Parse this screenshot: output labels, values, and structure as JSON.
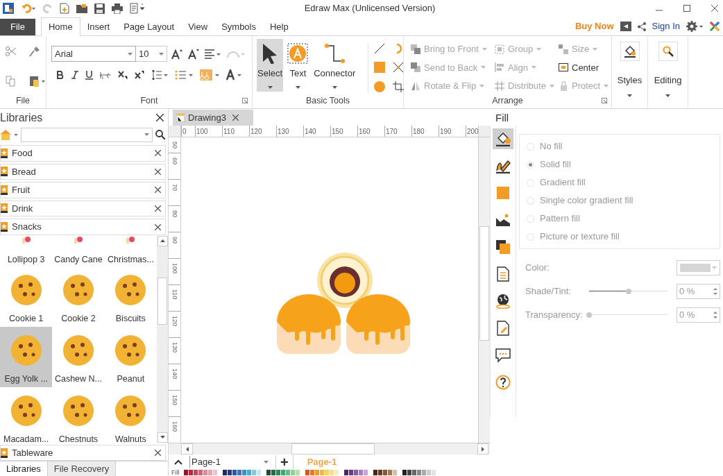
{
  "window": {
    "title": "Edraw Max (Unlicensed Version)"
  },
  "menu_tabs": [
    {
      "label": "File",
      "kind": "file",
      "selected": false
    },
    {
      "label": "Home",
      "kind": "tab",
      "selected": true
    },
    {
      "label": "Insert",
      "kind": "tab",
      "selected": false
    },
    {
      "label": "Page Layout",
      "kind": "tab",
      "selected": false
    },
    {
      "label": "View",
      "kind": "tab",
      "selected": false
    },
    {
      "label": "Symbols",
      "kind": "tab",
      "selected": false
    },
    {
      "label": "Help",
      "kind": "tab",
      "selected": false
    }
  ],
  "header_actions": {
    "buy_now": "Buy Now",
    "sign_in": "Sign In"
  },
  "ribbon": {
    "file_group": {
      "title": "File"
    },
    "font": {
      "title": "Font",
      "font_name": "Arial",
      "font_size": "10"
    },
    "basic_tools": {
      "title": "Basic Tools",
      "tools": [
        {
          "label": "Select",
          "selected": true
        },
        {
          "label": "Text",
          "selected": false
        },
        {
          "label": "Connector",
          "selected": false
        }
      ]
    },
    "arrange": {
      "title": "Arrange",
      "items": [
        {
          "label": "Bring to Front",
          "disabled": true,
          "dropdown": true
        },
        {
          "label": "Group",
          "disabled": true,
          "dropdown": true
        },
        {
          "label": "Size",
          "disabled": true,
          "dropdown": true
        },
        {
          "label": "Send to Back",
          "disabled": true,
          "dropdown": true
        },
        {
          "label": "Align",
          "disabled": true,
          "dropdown": true
        },
        {
          "label": "Center",
          "disabled": false,
          "dropdown": false
        },
        {
          "label": "Rotate & Flip",
          "disabled": true,
          "dropdown": true
        },
        {
          "label": "Distribute",
          "disabled": true,
          "dropdown": true
        },
        {
          "label": "Protect",
          "disabled": true,
          "dropdown": true
        }
      ]
    },
    "styles": {
      "label": "Styles"
    },
    "editing": {
      "label": "Editing"
    }
  },
  "libraries": {
    "title": "Libraries",
    "categories": [
      {
        "label": "Food",
        "expanded": false
      },
      {
        "label": "Bread",
        "expanded": false
      },
      {
        "label": "Fruit",
        "expanded": false
      },
      {
        "label": "Drink",
        "expanded": false
      },
      {
        "label": "Snacks",
        "expanded": true,
        "shapes": [
          {
            "label": "Lollipop 3",
            "selected": false
          },
          {
            "label": "Candy Cane",
            "selected": false
          },
          {
            "label": "Christmas...",
            "selected": false
          },
          {
            "label": "Cookie 1",
            "selected": false
          },
          {
            "label": "Cookie 2",
            "selected": false
          },
          {
            "label": "Biscuits",
            "selected": false
          },
          {
            "label": "Egg Yolk ...",
            "selected": true
          },
          {
            "label": "Cashew N...",
            "selected": false
          },
          {
            "label": "Peanut",
            "selected": false
          },
          {
            "label": "Macadam...",
            "selected": false
          },
          {
            "label": "Chestnuts",
            "selected": false
          },
          {
            "label": "Walnuts",
            "selected": false
          }
        ]
      },
      {
        "label": "Tableware",
        "expanded": false
      }
    ],
    "bottom_tabs": [
      {
        "label": "Libraries",
        "selected": true
      },
      {
        "label": "File Recovery",
        "selected": false
      }
    ]
  },
  "document_tab": {
    "label": "Drawing3"
  },
  "ruler": {
    "horizontal": [
      "0",
      "100",
      "110",
      "120",
      "130",
      "140",
      "150",
      "160",
      "170",
      "180",
      "190",
      "200"
    ],
    "vertical": [
      "50",
      "60",
      "70",
      "80",
      "90",
      "100",
      "110",
      "120",
      "130",
      "140",
      "150",
      "160"
    ]
  },
  "page_bar": {
    "page_select": "Page-1",
    "add": "+",
    "pages": [
      {
        "label": "Page-1",
        "selected": true
      }
    ]
  },
  "palette_label": "Fill",
  "side_tools": [
    {
      "kind": "fill",
      "selected": true
    },
    {
      "kind": "line",
      "selected": false
    },
    {
      "kind": "shadow",
      "selected": false
    },
    {
      "kind": "image",
      "selected": false
    },
    {
      "kind": "layer",
      "selected": false
    },
    {
      "kind": "page",
      "selected": false
    },
    {
      "kind": "globe",
      "selected": false
    },
    {
      "kind": "note",
      "selected": false
    },
    {
      "kind": "comment",
      "selected": false
    },
    {
      "kind": "help",
      "selected": false
    }
  ],
  "fill_panel": {
    "title": "Fill",
    "options": [
      {
        "label": "No fill",
        "selected": false,
        "disabled": true
      },
      {
        "label": "Solid fill",
        "selected": true,
        "disabled": true
      },
      {
        "label": "Gradient fill",
        "selected": false,
        "disabled": true
      },
      {
        "label": "Single color gradient fill",
        "selected": false,
        "disabled": true
      },
      {
        "label": "Pattern fill",
        "selected": false,
        "disabled": true
      },
      {
        "label": "Picture or texture fill",
        "selected": false,
        "disabled": true
      }
    ],
    "color_label": "Color:",
    "sliders": [
      {
        "label": "Shade/Tint:",
        "level": 0.5,
        "value": "0 %"
      },
      {
        "label": "Transparency:",
        "level": 0,
        "value": "0 %"
      }
    ]
  }
}
